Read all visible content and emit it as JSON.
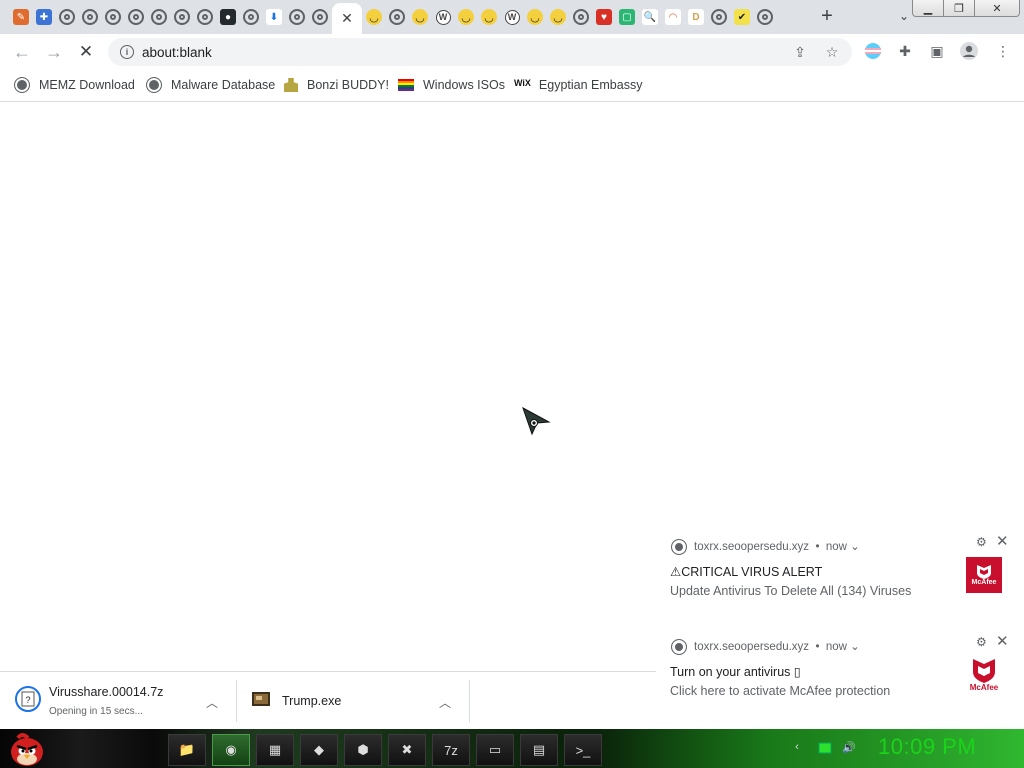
{
  "tabs": [
    {
      "icon": "paint-icon",
      "kind": "square",
      "color": "#e06b2e",
      "glyph": "✎"
    },
    {
      "icon": "puzzle-icon",
      "kind": "square",
      "color": "#3b74d4",
      "glyph": "✚"
    },
    {
      "icon": "globe-icon",
      "kind": "globe"
    },
    {
      "icon": "globe-icon",
      "kind": "globe"
    },
    {
      "icon": "globe-icon",
      "kind": "globe"
    },
    {
      "icon": "globe-icon",
      "kind": "globe"
    },
    {
      "icon": "globe-icon",
      "kind": "globe"
    },
    {
      "icon": "globe-icon",
      "kind": "globe"
    },
    {
      "icon": "globe-icon",
      "kind": "globe"
    },
    {
      "icon": "github-icon",
      "kind": "square",
      "color": "#24292e",
      "glyph": "●"
    },
    {
      "icon": "globe-icon",
      "kind": "globe"
    },
    {
      "icon": "download-icon",
      "kind": "square",
      "color": "#ffffff",
      "glyph": "⬇",
      "fg": "#1a73e8"
    },
    {
      "icon": "globe-icon",
      "kind": "globe"
    },
    {
      "icon": "globe-icon",
      "kind": "globe"
    },
    {
      "icon": "close-icon",
      "kind": "active"
    },
    {
      "icon": "smiley-icon",
      "kind": "smile"
    },
    {
      "icon": "globe-icon",
      "kind": "globe"
    },
    {
      "icon": "smiley-icon",
      "kind": "smile"
    },
    {
      "icon": "wordpress-icon",
      "kind": "wp"
    },
    {
      "icon": "smiley-icon",
      "kind": "smile"
    },
    {
      "icon": "smiley-icon",
      "kind": "smile"
    },
    {
      "icon": "wordpress-icon",
      "kind": "wp"
    },
    {
      "icon": "smiley-icon",
      "kind": "smile"
    },
    {
      "icon": "smiley-icon",
      "kind": "smile"
    },
    {
      "icon": "globe-icon",
      "kind": "globe"
    },
    {
      "icon": "shield-icon",
      "kind": "square",
      "color": "#d93025",
      "glyph": "♥"
    },
    {
      "icon": "app-icon",
      "kind": "square",
      "color": "#2bb673",
      "glyph": "▢"
    },
    {
      "icon": "search-icon",
      "kind": "square",
      "color": "#ffffff",
      "glyph": "🔍",
      "fg": "#1a73e8"
    },
    {
      "icon": "rainbow-icon",
      "kind": "square",
      "color": "#ffffff",
      "glyph": "◠",
      "fg": "#e0602c"
    },
    {
      "icon": "letter-d-icon",
      "kind": "square",
      "color": "#ffffff",
      "glyph": "D",
      "fg": "#d4a24c"
    },
    {
      "icon": "globe-icon",
      "kind": "globe"
    },
    {
      "icon": "check-icon",
      "kind": "square",
      "color": "#f2e14c",
      "glyph": "✔",
      "fg": "#222"
    },
    {
      "icon": "globe-icon",
      "kind": "globe"
    }
  ],
  "toolbar": {
    "url": "about:blank"
  },
  "bookmarks": [
    {
      "label": "MEMZ Download",
      "icon": "globe"
    },
    {
      "label": "Malware Database",
      "icon": "globe"
    },
    {
      "label": "Bonzi BUDDY!",
      "icon": "bonzi"
    },
    {
      "label": "Windows ISOs",
      "icon": "rainbow"
    },
    {
      "label": "Egyptian Embassy",
      "icon": "wix",
      "icon_text": "WiX"
    }
  ],
  "notifications": [
    {
      "source": "toxrx.seoopersedu.xyz",
      "time": "now",
      "title": "⚠CRITICAL VIRUS ALERT",
      "body": "Update Antivirus To Delete All (134) Viruses",
      "logo_text": "McAfee",
      "logo_style": "red-square"
    },
    {
      "source": "toxrx.seoopersedu.xyz",
      "time": "now",
      "title": "Turn on your antivirus ▯",
      "body": "Click here to activate McAfee protection",
      "logo_text": "McAfee",
      "logo_style": "shield"
    }
  ],
  "downloads": [
    {
      "name": "Virusshare.00014.7z",
      "status": "Opening in 15 secs..."
    },
    {
      "name": "Trump.exe",
      "status": ""
    }
  ],
  "taskbar": {
    "clock": "10:09 PM",
    "buttons": [
      {
        "icon": "folder-icon",
        "glyph": "📁"
      },
      {
        "icon": "chrome-icon",
        "glyph": "◉",
        "active": true
      },
      {
        "icon": "photo-icon",
        "glyph": "▦"
      },
      {
        "icon": "windows-shield-icon",
        "glyph": "◆"
      },
      {
        "icon": "antivirus-icon",
        "glyph": "⬢"
      },
      {
        "icon": "error-icon",
        "glyph": "✖"
      },
      {
        "icon": "7zip-icon",
        "glyph": "7z"
      },
      {
        "icon": "window-icon",
        "glyph": "▭"
      },
      {
        "icon": "control-panel-icon",
        "glyph": "▤"
      },
      {
        "icon": "cmd-icon",
        "glyph": ">_"
      }
    ]
  },
  "colors": {
    "accent": "#1a73e8",
    "mcafee_red": "#c8102e",
    "clock_green": "#1bd31b"
  }
}
